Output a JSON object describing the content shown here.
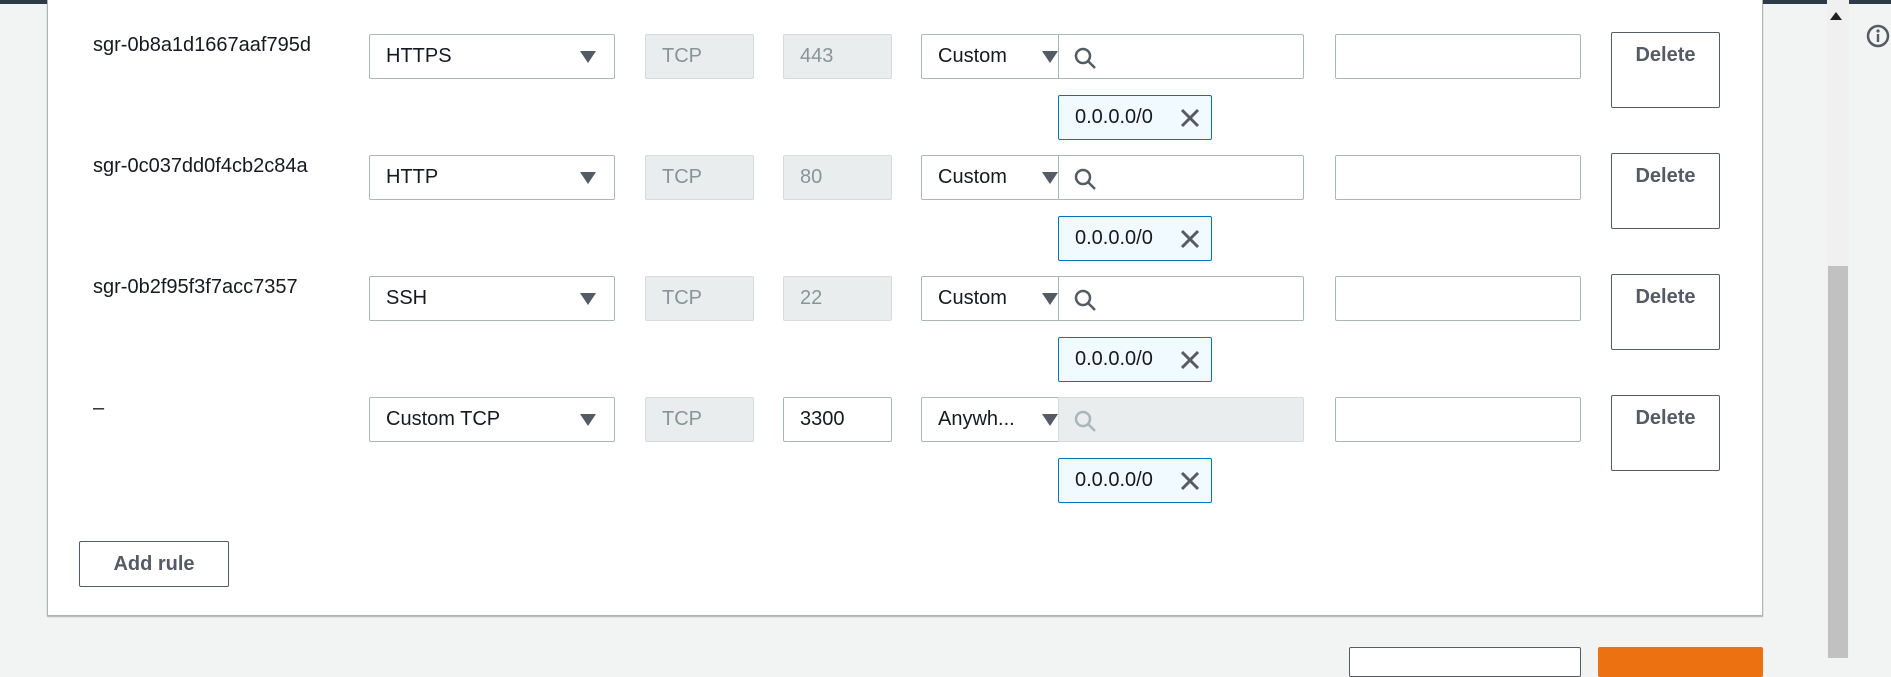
{
  "rules": [
    {
      "id": "sgr-0b8a1d1667aaf795d",
      "type": "HTTPS",
      "protocol": "TCP",
      "port": "443",
      "source_type": "Custom",
      "cidr": "0.0.0.0/0",
      "editable_port": false,
      "search_disabled": false
    },
    {
      "id": "sgr-0c037dd0f4cb2c84a",
      "type": "HTTP",
      "protocol": "TCP",
      "port": "80",
      "source_type": "Custom",
      "cidr": "0.0.0.0/0",
      "editable_port": false,
      "search_disabled": false
    },
    {
      "id": "sgr-0b2f95f3f7acc7357",
      "type": "SSH",
      "protocol": "TCP",
      "port": "22",
      "source_type": "Custom",
      "cidr": "0.0.0.0/0",
      "editable_port": false,
      "search_disabled": false
    },
    {
      "id": "–",
      "type": "Custom TCP",
      "protocol": "TCP",
      "port": "3300",
      "source_type": "Anywh...",
      "cidr": "0.0.0.0/0",
      "editable_port": true,
      "search_disabled": true
    }
  ],
  "delete_label": "Delete",
  "add_rule_label": "Add rule",
  "colors": {
    "accent_orange": "#ec7211",
    "token_border": "#0073bb",
    "token_bg": "#f1faff"
  }
}
